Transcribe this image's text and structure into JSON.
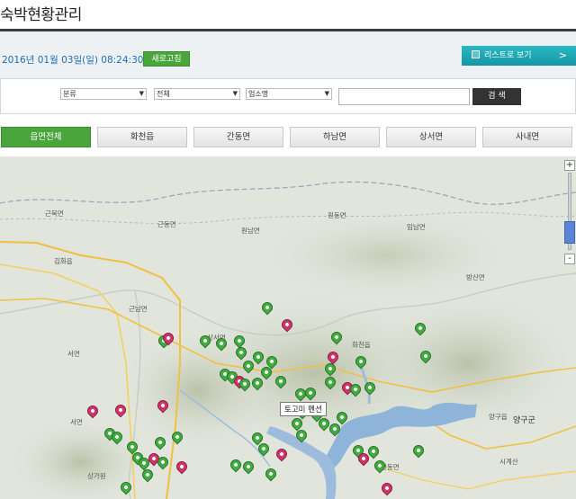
{
  "page": {
    "title": "숙박현황관리"
  },
  "status": {
    "datetime": "2016년 01월 03일(일) 08:24:30",
    "refresh_label": "새로고침"
  },
  "list_button": {
    "label": "리스트로 보기",
    "chevron": ">"
  },
  "filters": {
    "category": "분류",
    "region": "전체",
    "business_type": "업소명",
    "search_value": "",
    "search_label": "검 색"
  },
  "tabs": [
    {
      "label": "읍면전체",
      "active": true
    },
    {
      "label": "화천읍",
      "active": false
    },
    {
      "label": "간동면",
      "active": false
    },
    {
      "label": "하남면",
      "active": false
    },
    {
      "label": "상서면",
      "active": false
    },
    {
      "label": "사내면",
      "active": false
    }
  ],
  "map": {
    "tooltip": "토고미 펜션",
    "zoom_in": "+",
    "zoom_out": "-",
    "labels": [
      "근북면",
      "근동면",
      "원동면",
      "원남면",
      "임남면",
      "김화읍",
      "방산면",
      "근남면",
      "상서면",
      "화천읍",
      "서면",
      "양구읍",
      "양구군",
      "시계산",
      "간동면",
      "상가원",
      "서면"
    ],
    "road_numbers": [
      "5",
      "43",
      "47",
      "56",
      "464",
      "463",
      "461",
      "31"
    ],
    "colors": {
      "green_marker": "#3fae3f",
      "pink_marker": "#d0336a",
      "water": "#8fb4d9",
      "active_tab": "#4aa53c",
      "list_button": "#1fa8b6"
    }
  }
}
